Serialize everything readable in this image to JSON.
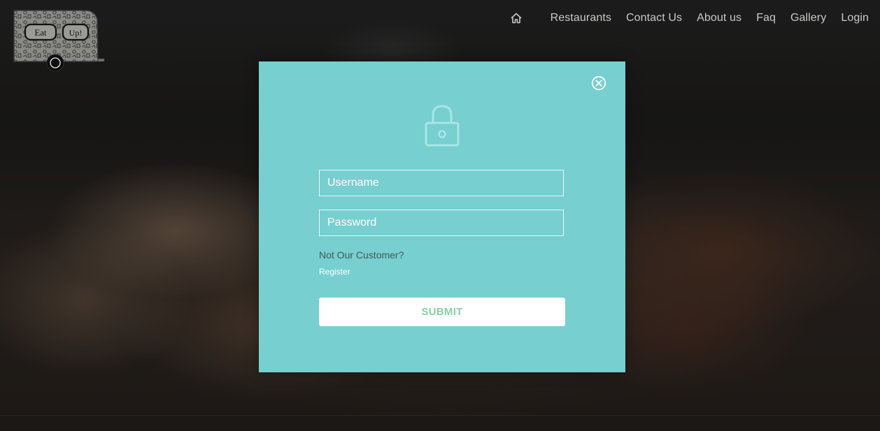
{
  "logo": {
    "left_text": "Eat",
    "right_text": "Up!"
  },
  "nav": {
    "home_icon": "home-icon",
    "items": [
      "Restaurants",
      "Contact Us",
      "About us",
      "Faq",
      "Gallery",
      "Login"
    ]
  },
  "login_modal": {
    "close_icon": "close-circle-icon",
    "lock_icon": "lock-icon",
    "username_placeholder": "Username",
    "password_placeholder": "Password",
    "not_customer_text": "Not Our Customer?",
    "register_label": "Register",
    "submit_label": "SUBMIT"
  },
  "colors": {
    "modal_bg": "#77cfcf",
    "submit_text": "#86d1a4",
    "nav_text": "#c9c9c9"
  }
}
